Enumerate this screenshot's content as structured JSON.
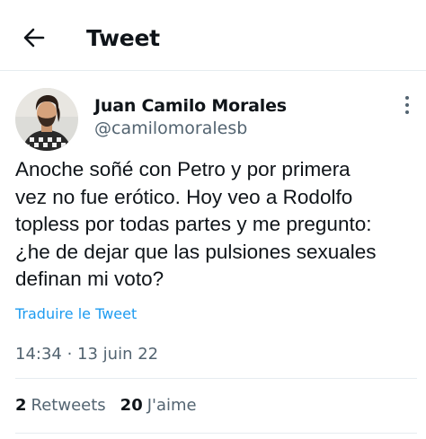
{
  "header": {
    "title": "Tweet",
    "back_icon": "arrow-left-icon"
  },
  "author": {
    "name": "Juan Camilo Morales",
    "handle": "@camilomoralesb",
    "more_icon": "more-vertical-icon"
  },
  "tweet": {
    "lines": [
      "Anoche soñé con Petro y por primera",
      "vez no fue erótico. Hoy veo a Rodolfo",
      "topless por todas partes y me pregunto:",
      "¿he de dejar que las pulsiones sexuales",
      "definan mi voto?"
    ],
    "translate_label": "Traduire le Tweet",
    "timestamp": "14:34 · 13 juin 22"
  },
  "stats": {
    "retweets_count": "2",
    "retweets_label": "Retweets",
    "likes_count": "20",
    "likes_label": "J'aime"
  },
  "colors": {
    "text_primary": "#0f1419",
    "text_secondary": "#536471",
    "link": "#1d9bf0",
    "divider": "#e6ecf0"
  }
}
